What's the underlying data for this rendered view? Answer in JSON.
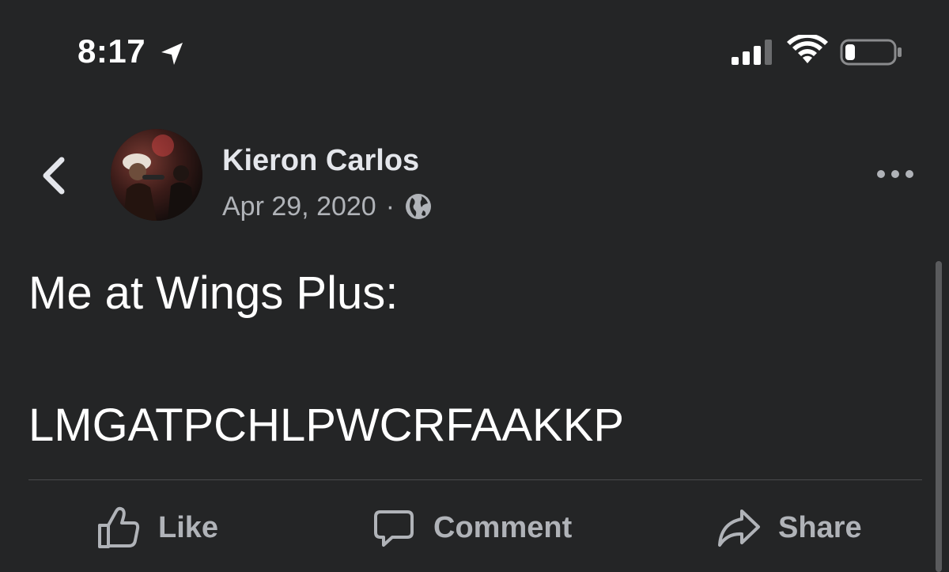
{
  "status_bar": {
    "time": "8:17",
    "location_icon": "location-arrow-icon",
    "signal_icon": "cellular-signal-icon",
    "wifi_icon": "wifi-icon",
    "battery_icon": "battery-icon",
    "battery_level": 0.2
  },
  "post": {
    "author_name": "Kieron Carlos",
    "date": "Apr 29, 2020",
    "separator": "·",
    "privacy_icon": "globe-icon",
    "text_line_1": "Me at Wings Plus:",
    "text_line_2": "LMGATPCHLPWCRFAAKKP"
  },
  "actions": {
    "like_label": "Like",
    "comment_label": "Comment",
    "share_label": "Share"
  },
  "colors": {
    "background": "#242526",
    "primary_text": "#e4e6eb",
    "secondary_text": "#b0b3b8"
  }
}
